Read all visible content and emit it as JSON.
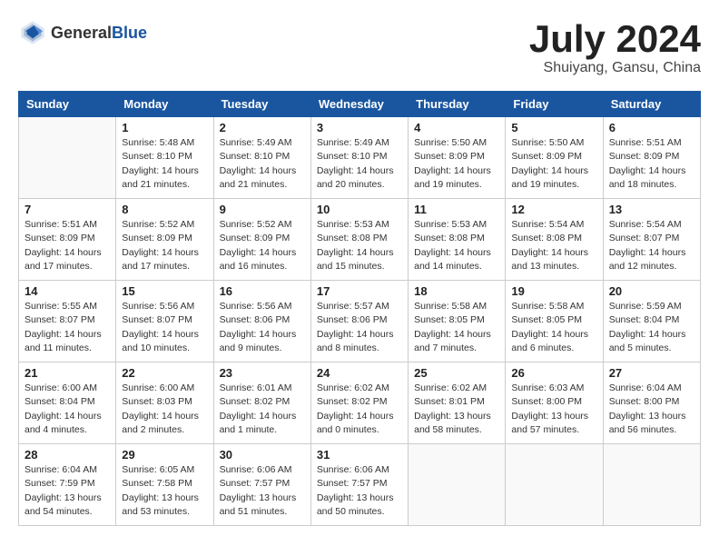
{
  "header": {
    "logo_general": "General",
    "logo_blue": "Blue",
    "month_title": "July 2024",
    "location": "Shuiyang, Gansu, China"
  },
  "calendar": {
    "days_of_week": [
      "Sunday",
      "Monday",
      "Tuesday",
      "Wednesday",
      "Thursday",
      "Friday",
      "Saturday"
    ],
    "weeks": [
      [
        {
          "day": "",
          "info": ""
        },
        {
          "day": "1",
          "info": "Sunrise: 5:48 AM\nSunset: 8:10 PM\nDaylight: 14 hours\nand 21 minutes."
        },
        {
          "day": "2",
          "info": "Sunrise: 5:49 AM\nSunset: 8:10 PM\nDaylight: 14 hours\nand 21 minutes."
        },
        {
          "day": "3",
          "info": "Sunrise: 5:49 AM\nSunset: 8:10 PM\nDaylight: 14 hours\nand 20 minutes."
        },
        {
          "day": "4",
          "info": "Sunrise: 5:50 AM\nSunset: 8:09 PM\nDaylight: 14 hours\nand 19 minutes."
        },
        {
          "day": "5",
          "info": "Sunrise: 5:50 AM\nSunset: 8:09 PM\nDaylight: 14 hours\nand 19 minutes."
        },
        {
          "day": "6",
          "info": "Sunrise: 5:51 AM\nSunset: 8:09 PM\nDaylight: 14 hours\nand 18 minutes."
        }
      ],
      [
        {
          "day": "7",
          "info": "Sunrise: 5:51 AM\nSunset: 8:09 PM\nDaylight: 14 hours\nand 17 minutes."
        },
        {
          "day": "8",
          "info": "Sunrise: 5:52 AM\nSunset: 8:09 PM\nDaylight: 14 hours\nand 17 minutes."
        },
        {
          "day": "9",
          "info": "Sunrise: 5:52 AM\nSunset: 8:09 PM\nDaylight: 14 hours\nand 16 minutes."
        },
        {
          "day": "10",
          "info": "Sunrise: 5:53 AM\nSunset: 8:08 PM\nDaylight: 14 hours\nand 15 minutes."
        },
        {
          "day": "11",
          "info": "Sunrise: 5:53 AM\nSunset: 8:08 PM\nDaylight: 14 hours\nand 14 minutes."
        },
        {
          "day": "12",
          "info": "Sunrise: 5:54 AM\nSunset: 8:08 PM\nDaylight: 14 hours\nand 13 minutes."
        },
        {
          "day": "13",
          "info": "Sunrise: 5:54 AM\nSunset: 8:07 PM\nDaylight: 14 hours\nand 12 minutes."
        }
      ],
      [
        {
          "day": "14",
          "info": "Sunrise: 5:55 AM\nSunset: 8:07 PM\nDaylight: 14 hours\nand 11 minutes."
        },
        {
          "day": "15",
          "info": "Sunrise: 5:56 AM\nSunset: 8:07 PM\nDaylight: 14 hours\nand 10 minutes."
        },
        {
          "day": "16",
          "info": "Sunrise: 5:56 AM\nSunset: 8:06 PM\nDaylight: 14 hours\nand 9 minutes."
        },
        {
          "day": "17",
          "info": "Sunrise: 5:57 AM\nSunset: 8:06 PM\nDaylight: 14 hours\nand 8 minutes."
        },
        {
          "day": "18",
          "info": "Sunrise: 5:58 AM\nSunset: 8:05 PM\nDaylight: 14 hours\nand 7 minutes."
        },
        {
          "day": "19",
          "info": "Sunrise: 5:58 AM\nSunset: 8:05 PM\nDaylight: 14 hours\nand 6 minutes."
        },
        {
          "day": "20",
          "info": "Sunrise: 5:59 AM\nSunset: 8:04 PM\nDaylight: 14 hours\nand 5 minutes."
        }
      ],
      [
        {
          "day": "21",
          "info": "Sunrise: 6:00 AM\nSunset: 8:04 PM\nDaylight: 14 hours\nand 4 minutes."
        },
        {
          "day": "22",
          "info": "Sunrise: 6:00 AM\nSunset: 8:03 PM\nDaylight: 14 hours\nand 2 minutes."
        },
        {
          "day": "23",
          "info": "Sunrise: 6:01 AM\nSunset: 8:02 PM\nDaylight: 14 hours\nand 1 minute."
        },
        {
          "day": "24",
          "info": "Sunrise: 6:02 AM\nSunset: 8:02 PM\nDaylight: 14 hours\nand 0 minutes."
        },
        {
          "day": "25",
          "info": "Sunrise: 6:02 AM\nSunset: 8:01 PM\nDaylight: 13 hours\nand 58 minutes."
        },
        {
          "day": "26",
          "info": "Sunrise: 6:03 AM\nSunset: 8:00 PM\nDaylight: 13 hours\nand 57 minutes."
        },
        {
          "day": "27",
          "info": "Sunrise: 6:04 AM\nSunset: 8:00 PM\nDaylight: 13 hours\nand 56 minutes."
        }
      ],
      [
        {
          "day": "28",
          "info": "Sunrise: 6:04 AM\nSunset: 7:59 PM\nDaylight: 13 hours\nand 54 minutes."
        },
        {
          "day": "29",
          "info": "Sunrise: 6:05 AM\nSunset: 7:58 PM\nDaylight: 13 hours\nand 53 minutes."
        },
        {
          "day": "30",
          "info": "Sunrise: 6:06 AM\nSunset: 7:57 PM\nDaylight: 13 hours\nand 51 minutes."
        },
        {
          "day": "31",
          "info": "Sunrise: 6:06 AM\nSunset: 7:57 PM\nDaylight: 13 hours\nand 50 minutes."
        },
        {
          "day": "",
          "info": ""
        },
        {
          "day": "",
          "info": ""
        },
        {
          "day": "",
          "info": ""
        }
      ]
    ]
  }
}
